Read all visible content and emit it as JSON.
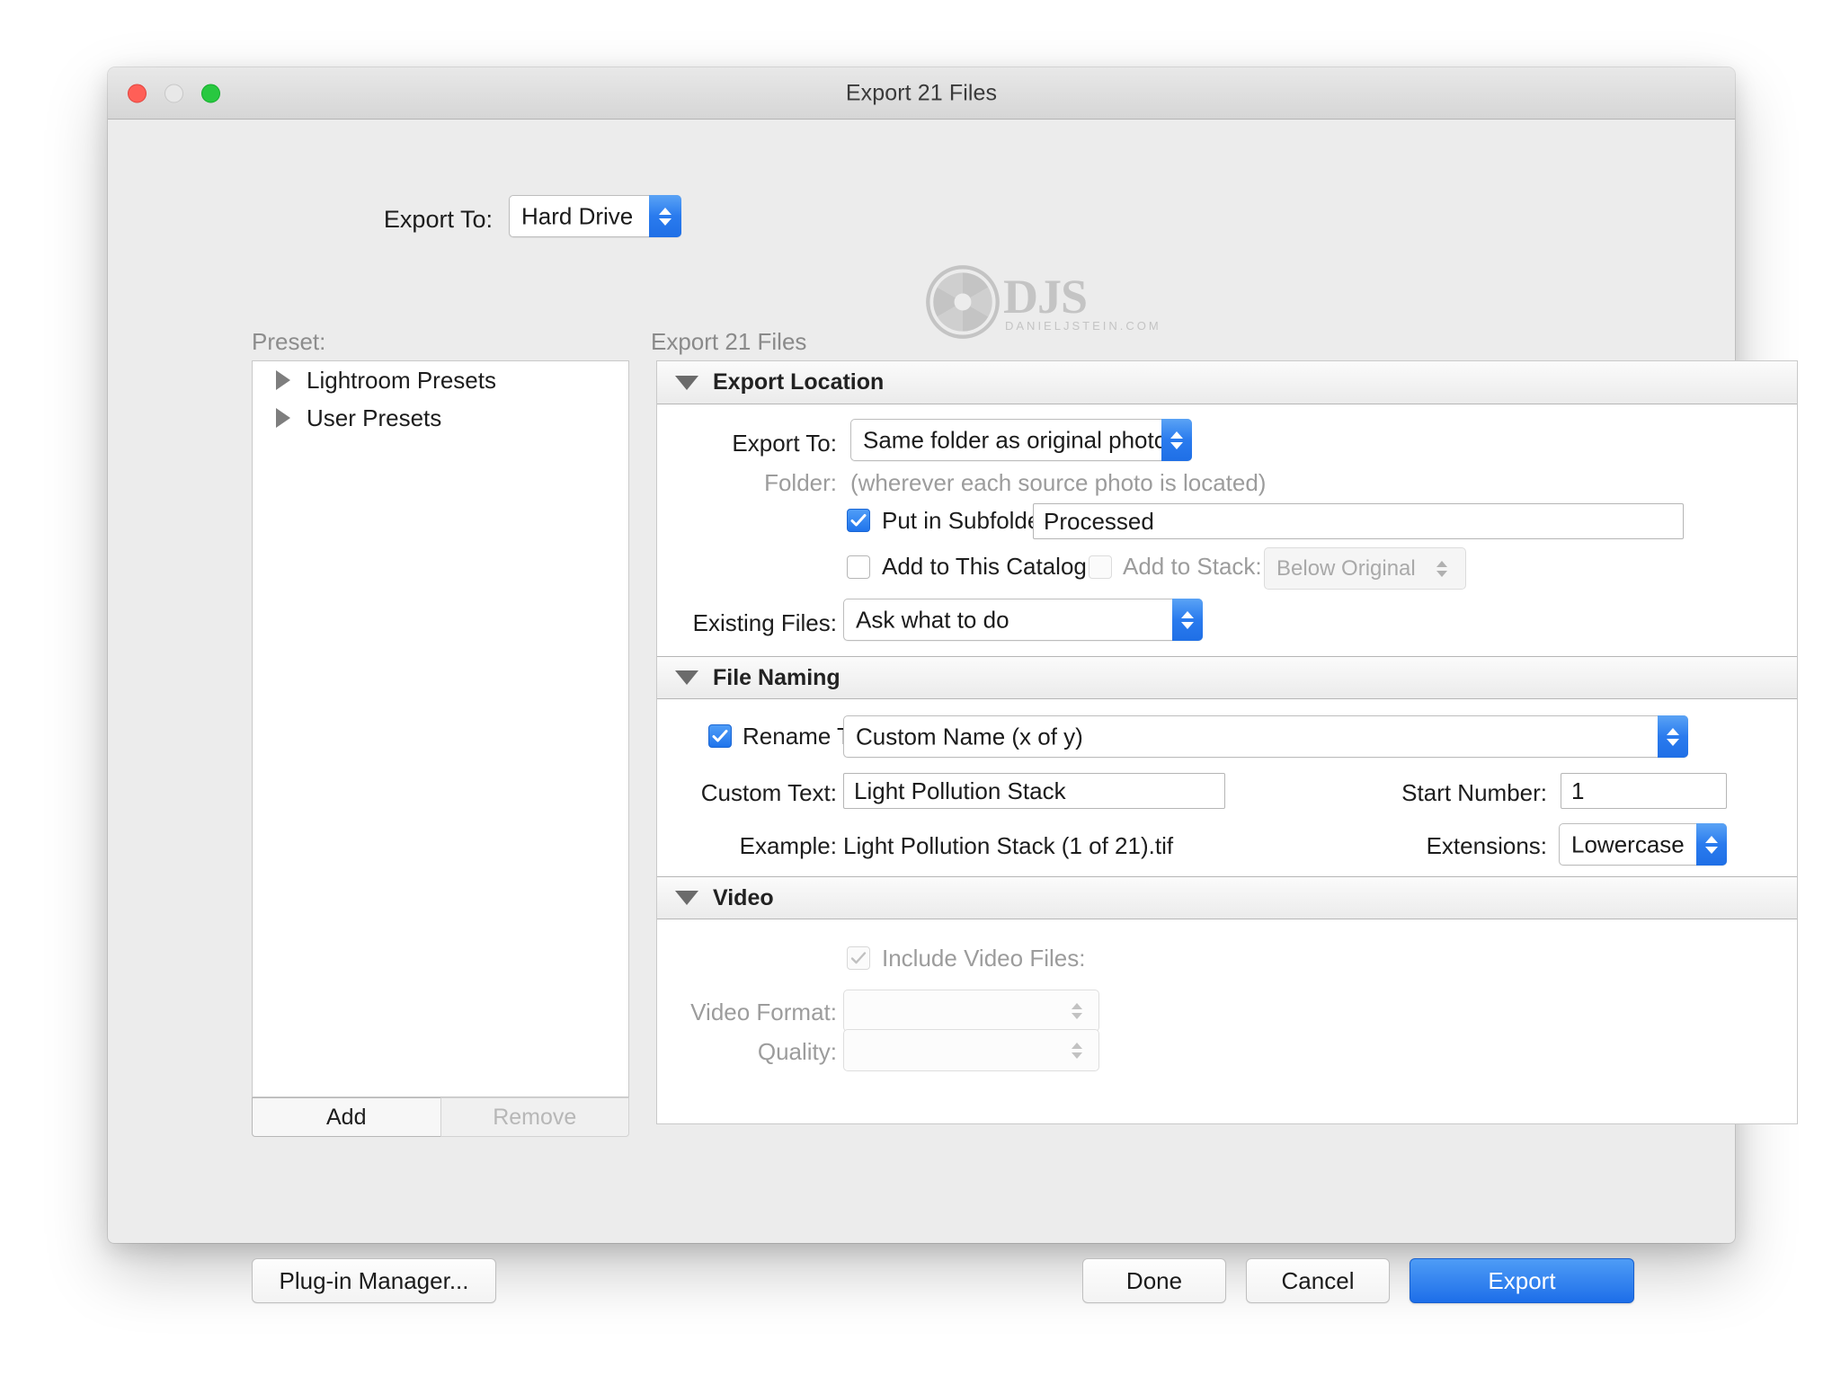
{
  "window": {
    "title": "Export 21 Files",
    "traffic_lights": [
      "close-button",
      "minimize-button",
      "zoom-button"
    ]
  },
  "header": {
    "export_to_label": "Export To:",
    "export_to_value": "Hard Drive",
    "files_subtitle": "Export 21 Files",
    "logo": {
      "wordmark": "DJS",
      "tagline": "DANIELJSTEIN.COM",
      "color": "#c4c4c4"
    }
  },
  "sidebar": {
    "preset_label": "Preset:",
    "items": [
      {
        "label": "Lightroom Presets",
        "expanded": false
      },
      {
        "label": "User Presets",
        "expanded": false
      }
    ],
    "add_label": "Add",
    "remove_label": "Remove"
  },
  "sections": {
    "export_location": {
      "title": "Export Location",
      "export_to_label": "Export To:",
      "export_to_value": "Same folder as original photo",
      "folder_label": "Folder:",
      "folder_value": "(wherever each source photo is located)",
      "put_in_subfolder_label": "Put in Subfolder:",
      "put_in_subfolder_checked": true,
      "subfolder_value": "Processed",
      "add_to_catalog_label": "Add to This Catalog",
      "add_to_catalog_checked": false,
      "add_to_stack_label": "Add to Stack:",
      "add_to_stack_checked": false,
      "add_to_stack_value": "Below Original",
      "existing_files_label": "Existing Files:",
      "existing_files_value": "Ask what to do"
    },
    "file_naming": {
      "title": "File Naming",
      "rename_to_label": "Rename To:",
      "rename_to_checked": true,
      "rename_to_value": "Custom Name (x of y)",
      "custom_text_label": "Custom Text:",
      "custom_text_value": "Light Pollution Stack",
      "start_number_label": "Start Number:",
      "start_number_value": "1",
      "example_label": "Example:",
      "example_value": "Light Pollution Stack (1 of 21).tif",
      "extensions_label": "Extensions:",
      "extensions_value": "Lowercase"
    },
    "video": {
      "title": "Video",
      "include_video_label": "Include Video Files:",
      "include_video_checked": true,
      "video_format_label": "Video Format:",
      "video_format_value": "",
      "quality_label": "Quality:",
      "quality_value": ""
    }
  },
  "footer": {
    "plugin_manager_label": "Plug-in Manager...",
    "done_label": "Done",
    "cancel_label": "Cancel",
    "export_label": "Export"
  },
  "colors": {
    "accent": "#1d6ee9",
    "window_bg": "#ececec",
    "panel_bg": "#ffffff",
    "disabled_text": "#9c9c9c"
  }
}
